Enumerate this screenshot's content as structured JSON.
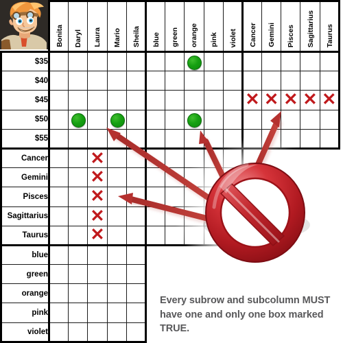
{
  "puzzle": {
    "title": "Logic puzzle grid",
    "caption": "Every subrow and subcolumn MUST have one and only one box marked TRUE.",
    "avatar_name": "puzzle-mascot-avatar",
    "columns": [
      {
        "label": "Bonita",
        "group": "people"
      },
      {
        "label": "Daryl",
        "group": "people"
      },
      {
        "label": "Laura",
        "group": "people"
      },
      {
        "label": "Mario",
        "group": "people"
      },
      {
        "label": "Sheila",
        "group": "people"
      },
      {
        "label": "blue",
        "group": "colors"
      },
      {
        "label": "green",
        "group": "colors"
      },
      {
        "label": "orange",
        "group": "colors"
      },
      {
        "label": "pink",
        "group": "colors"
      },
      {
        "label": "violet",
        "group": "colors"
      },
      {
        "label": "Cancer",
        "group": "signs"
      },
      {
        "label": "Gemini",
        "group": "signs"
      },
      {
        "label": "Pisces",
        "group": "signs"
      },
      {
        "label": "Sagittarius",
        "group": "signs"
      },
      {
        "label": "Taurus",
        "group": "signs"
      }
    ],
    "rows": [
      {
        "label": "$35",
        "group": "prices",
        "span": 15
      },
      {
        "label": "$40",
        "group": "prices",
        "span": 15
      },
      {
        "label": "$45",
        "group": "prices",
        "span": 15
      },
      {
        "label": "$50",
        "group": "prices",
        "span": 15
      },
      {
        "label": "$55",
        "group": "prices",
        "span": 15
      },
      {
        "label": "Cancer",
        "group": "signs",
        "span": 10
      },
      {
        "label": "Gemini",
        "group": "signs",
        "span": 10
      },
      {
        "label": "Pisces",
        "group": "signs",
        "span": 10
      },
      {
        "label": "Sagittarius",
        "group": "signs",
        "span": 10
      },
      {
        "label": "Taurus",
        "group": "signs",
        "span": 10
      },
      {
        "label": "blue",
        "group": "colors",
        "span": 5
      },
      {
        "label": "green",
        "group": "colors",
        "span": 5
      },
      {
        "label": "orange",
        "group": "colors",
        "span": 5
      },
      {
        "label": "pink",
        "group": "colors",
        "span": 5
      },
      {
        "label": "violet",
        "group": "colors",
        "span": 5
      }
    ],
    "marks": [
      {
        "row": "$35",
        "col": "orange",
        "value": "true"
      },
      {
        "row": "$50",
        "col": "Daryl",
        "value": "true"
      },
      {
        "row": "$50",
        "col": "Mario",
        "value": "true"
      },
      {
        "row": "$50",
        "col": "orange",
        "value": "true"
      },
      {
        "row": "$45",
        "col": "Cancer",
        "value": "false"
      },
      {
        "row": "$45",
        "col": "Gemini",
        "value": "false"
      },
      {
        "row": "$45",
        "col": "Pisces",
        "value": "false"
      },
      {
        "row": "$45",
        "col": "Sagittarius",
        "value": "false"
      },
      {
        "row": "$45",
        "col": "Taurus",
        "value": "false"
      },
      {
        "row": "Cancer",
        "col": "Laura",
        "value": "false"
      },
      {
        "row": "Gemini",
        "col": "Laura",
        "value": "false"
      },
      {
        "row": "Pisces",
        "col": "Laura",
        "value": "false"
      },
      {
        "row": "Sagittarius",
        "col": "Laura",
        "value": "false"
      },
      {
        "row": "Taurus",
        "col": "Laura",
        "value": "false"
      }
    ],
    "marker_glyphs": {
      "true": "",
      "false": "✕"
    },
    "colors": {
      "true_marker": "#16a012",
      "false_marker": "#c0191c",
      "grid_line": "#1a1a1a",
      "grid_block_line": "#000000",
      "caption_text": "#58585a",
      "prohibition_sign": "#c1272d",
      "arrow": "#b5312f"
    },
    "annotation": {
      "sign_name": "prohibition-no-entry-sign",
      "arrow_count": 4,
      "arrows": [
        {
          "name": "arrow-to-sheila-55",
          "points_to": "Sheila / $55"
        },
        {
          "name": "arrow-to-orange-50",
          "points_to": "orange / $50"
        },
        {
          "name": "arrow-to-laura-pisces",
          "points_to": "Laura / Pisces"
        },
        {
          "name": "arrow-to-pisces-45",
          "points_to": "Pisces / $45"
        }
      ]
    }
  }
}
